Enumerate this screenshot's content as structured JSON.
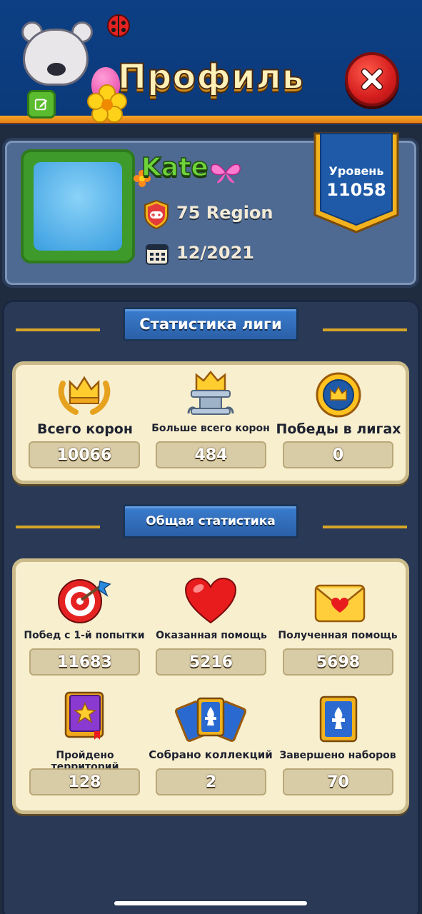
{
  "header": {
    "title": "Профиль",
    "close_icon": "close-x-icon"
  },
  "profile": {
    "username": "Kate",
    "region": "75 Region",
    "date": "12/2021",
    "level_label": "Уровень",
    "level_value": "11058"
  },
  "league_stats": {
    "title": "Статистика лиги",
    "items": [
      {
        "label": "Всего корон",
        "value": "10066",
        "icon": "crown-laurel-icon"
      },
      {
        "label": "Больше всего корон",
        "value": "484",
        "icon": "crown-pedestal-icon"
      },
      {
        "label": "Победы в лигах",
        "value": "0",
        "icon": "crown-medal-icon"
      }
    ]
  },
  "general_stats": {
    "title": "Общая статистика",
    "items": [
      {
        "label": "Побед с 1-й попытки",
        "value": "11683",
        "icon": "target-dart-icon"
      },
      {
        "label": "Оказанная помощь",
        "value": "5216",
        "icon": "heart-icon"
      },
      {
        "label": "Полученная помощь",
        "value": "5698",
        "icon": "heart-envelope-icon"
      },
      {
        "label": "Пройдено территорий",
        "value": "128",
        "icon": "star-book-icon"
      },
      {
        "label": "Собрано коллекций",
        "value": "2",
        "icon": "card-fan-icon"
      },
      {
        "label": "Завершено наборов",
        "value": "70",
        "icon": "fleur-card-icon"
      }
    ]
  },
  "colors": {
    "header_blue": "#0d3f84",
    "accent_orange": "#f6a223",
    "card_bg": "#f8efcf",
    "ribbon_blue": "#3b7dcf"
  }
}
